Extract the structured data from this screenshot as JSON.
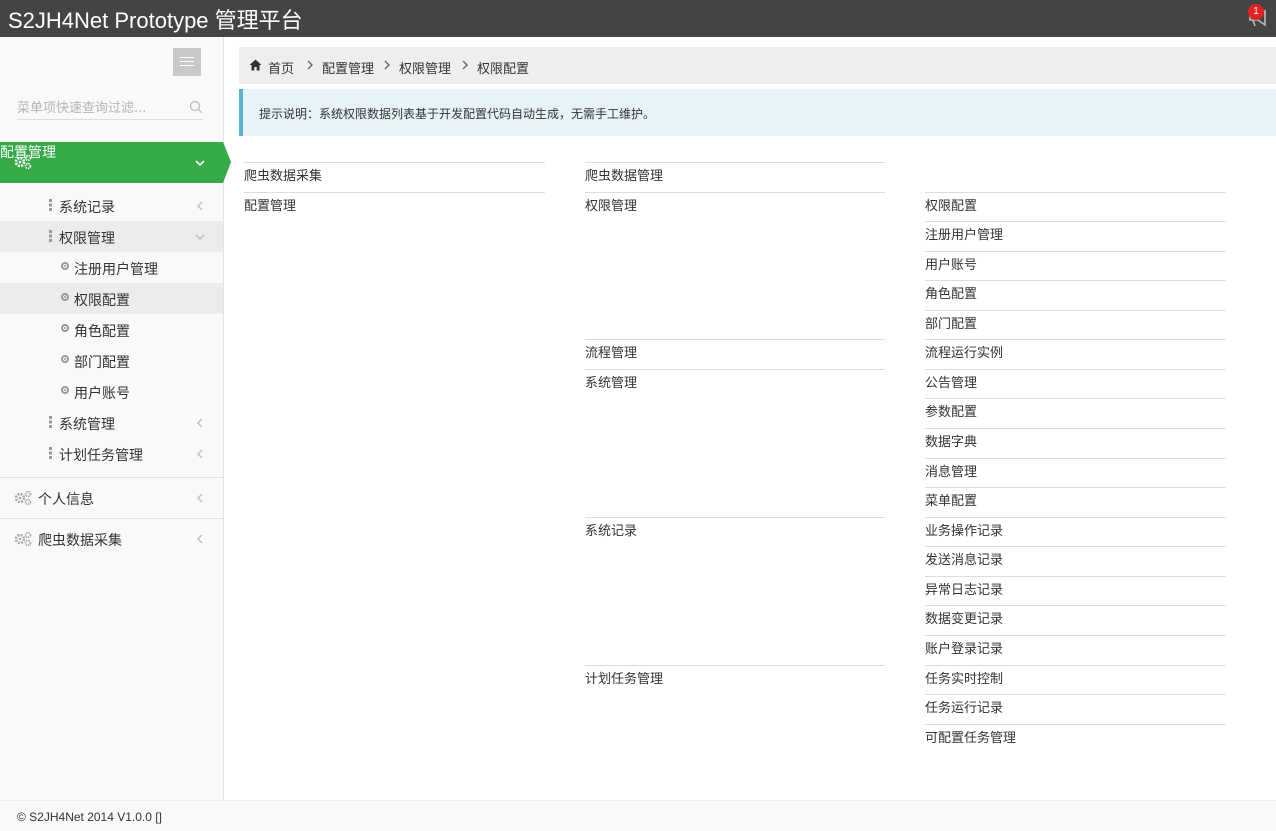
{
  "header": {
    "title": "S2JH4Net Prototype 管理平台",
    "notification_count": "1",
    "bell_icon": "bullhorn-icon"
  },
  "sidebar": {
    "search_placeholder": "菜单项快速查询过滤...",
    "active_menu": "配置管理",
    "sub_items": [
      {
        "label": "系统记录"
      },
      {
        "label": "权限管理"
      },
      {
        "label": "注册用户管理"
      },
      {
        "label": "权限配置"
      },
      {
        "label": "角色配置"
      },
      {
        "label": "部门配置"
      },
      {
        "label": "用户账号"
      },
      {
        "label": "系统管理"
      },
      {
        "label": "计划任务管理"
      }
    ],
    "top_menus": [
      {
        "label": "个人信息"
      },
      {
        "label": "爬虫数据采集"
      }
    ],
    "colors": {
      "active": "#35aa47",
      "header": "#444444"
    }
  },
  "breadcrumb": [
    "首页",
    "配置管理",
    "权限管理",
    "权限配置"
  ],
  "note": "提示说明：系统权限数据列表基于开发配置代码自动生成，无需手工维护。",
  "tree": {
    "level1": [
      "爬虫数据采集",
      "配置管理"
    ],
    "level2": [
      "爬虫数据管理",
      "权限管理",
      "流程管理",
      "系统管理",
      "系统记录",
      "计划任务管理"
    ],
    "level3": [
      "权限配置",
      "注册用户管理",
      "用户账号",
      "角色配置",
      "部门配置",
      "流程运行实例",
      "公告管理",
      "参数配置",
      "数据字典",
      "消息管理",
      "菜单配置",
      "业务操作记录",
      "发送消息记录",
      "异常日志记录",
      "数据变更记录",
      "账户登录记录",
      "任务实时控制",
      "任务运行记录",
      "可配置任务管理"
    ]
  },
  "footer": "© S2JH4Net 2014 V1.0.0 []"
}
